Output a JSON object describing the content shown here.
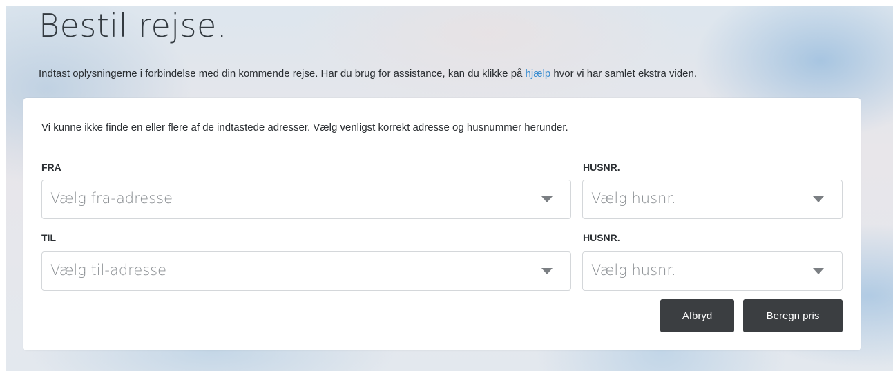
{
  "page": {
    "title": "Bestil rejse.",
    "intro_before": "Indtast oplysningerne i forbindelse med din kommende rejse. Har du brug for assistance, kan du klikke på ",
    "intro_link": "hjælp",
    "intro_after": " hvor vi har samlet ekstra viden."
  },
  "form": {
    "notice": "Vi kunne ikke finde en eller flere af de indtastede adresser. Vælg venligst korrekt adresse og husnummer herunder.",
    "from_label": "FRA",
    "from_placeholder": "Vælg fra-adresse",
    "from_house_label": "HUSNR.",
    "from_house_placeholder": "Vælg husnr.",
    "to_label": "TIL",
    "to_placeholder": "Vælg til-adresse",
    "to_house_label": "HUSNR.",
    "to_house_placeholder": "Vælg husnr.",
    "cancel_label": "Afbryd",
    "calculate_label": "Beregn pris"
  },
  "colors": {
    "link": "#3d8fd1",
    "button": "#3b3e41"
  },
  "icons": {
    "dropdown": "caret-down-icon"
  }
}
